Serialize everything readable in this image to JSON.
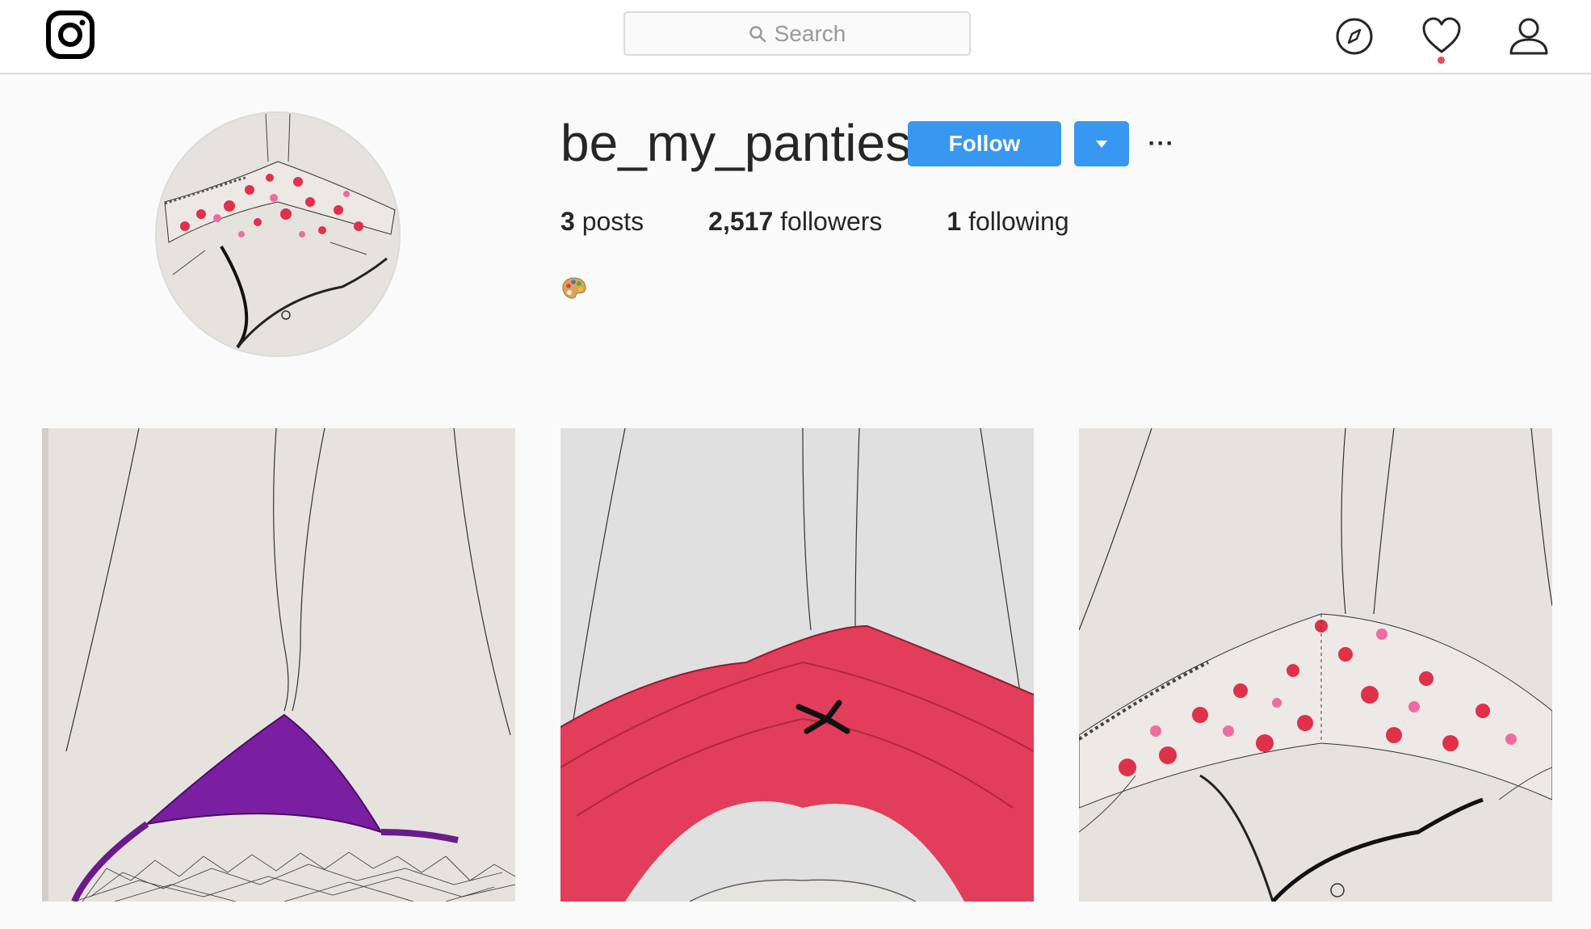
{
  "header": {
    "logo_icon": "instagram-camera-icon",
    "search": {
      "icon": "search-icon",
      "placeholder": "Search"
    },
    "nav": [
      {
        "icon": "compass-icon",
        "name": "explore"
      },
      {
        "icon": "heart-icon",
        "name": "activity",
        "has_notification": true
      },
      {
        "icon": "person-icon",
        "name": "profile"
      }
    ]
  },
  "profile": {
    "username": "be_my_panties",
    "follow_label": "Follow",
    "dropdown_icon": "caret-down-icon",
    "more_label": "···",
    "stats": {
      "posts_count": "3",
      "posts_label": "posts",
      "followers_count": "2,517",
      "followers_label": "followers",
      "following_count": "1",
      "following_label": "following"
    },
    "bio_icon": "artist-palette-icon"
  },
  "posts": [
    {
      "thumbnail": "purple-panties-drawing"
    },
    {
      "thumbnail": "red-lace-panties-drawing"
    },
    {
      "thumbnail": "floral-panties-drawing"
    }
  ],
  "colors": {
    "accent": "#3897f0",
    "notification": "#ed4956",
    "background": "#fafafa",
    "border": "#dbdbdb"
  }
}
